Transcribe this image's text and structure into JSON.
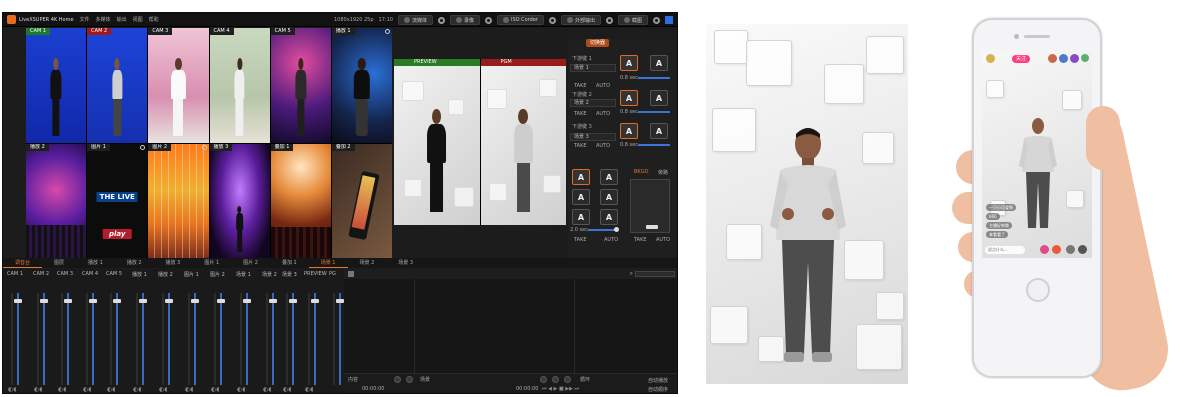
{
  "app": {
    "title": "LiveXSUPER 4K Home",
    "menu": [
      "文件",
      "多媒体",
      "输出",
      "视图",
      "帮助"
    ],
    "format": "1080x1920 25p",
    "clock": "17:10",
    "buttons": {
      "stream": "流媒体",
      "record": "录像",
      "iso": "ISO Corder",
      "external": "外部输出",
      "screenshot": "截图"
    }
  },
  "multiview": [
    {
      "label": "CAM 1",
      "state": "preview"
    },
    {
      "label": "CAM 2",
      "state": "program"
    },
    {
      "label": "CAM 3",
      "state": ""
    },
    {
      "label": "CAM 4",
      "state": ""
    },
    {
      "label": "CAM 5",
      "state": ""
    },
    {
      "label": "播放 1",
      "state": ""
    },
    {
      "label": "播放 2",
      "state": ""
    },
    {
      "label": "图片 1",
      "state": ""
    },
    {
      "label": "图片 2",
      "state": ""
    },
    {
      "label": "播放 3",
      "state": ""
    },
    {
      "label": "叠加 1",
      "state": ""
    },
    {
      "label": "叠加 2",
      "state": ""
    }
  ],
  "overlays": {
    "live": "THE LIVE",
    "play": "play"
  },
  "monitors": {
    "preview": "PREVIEW",
    "program": "PGM"
  },
  "transition": {
    "tab": "切换器",
    "groups": [
      {
        "title": "下游键 1",
        "source": "场景 1",
        "duration": "0.8 sec"
      },
      {
        "title": "下游键 2",
        "source": "场景 2",
        "duration": "0.8 sec"
      },
      {
        "title": "下游键 3",
        "source": "场景 3",
        "duration": "0.8 sec"
      }
    ],
    "take": "TAKE",
    "auto": "AUTO",
    "a": "A",
    "main_duration": "2.0 sec",
    "ftb": "BKGD",
    "ftb2": "旁路"
  },
  "bottom_tabs": [
    "调音台",
    "图层",
    "播放 1",
    "播放 2",
    "播放 3",
    "图片 1",
    "图片 2",
    "叠加 1",
    "场景 1",
    "场景 2",
    "场景 3"
  ],
  "mixer_channels": [
    "CAM 1",
    "CAM 2",
    "CAM 3",
    "CAM 4",
    "CAM 5",
    "播放 1",
    "播放 2",
    "图片 1",
    "图片 2",
    "场景 1",
    "场景 2",
    "场景 3",
    "PREVIEW",
    "PG"
  ],
  "media": {
    "footer_left": "内容",
    "footer_mid": "场景",
    "time_left": "00:00:00",
    "time_right": "00:00:00",
    "loop": "循环",
    "auto_play": "自动播放",
    "auto_next": "自动顺序"
  },
  "phone": {
    "follow": "关注",
    "chat": [
      "一只小可爱啊",
      "666",
      "主播好帅哦",
      "来看看了"
    ],
    "input_placeholder": "说点什么..."
  },
  "colors": {
    "accent": "#e46a1d",
    "preview": "#2a7b22",
    "program": "#9a1b1b",
    "fader": "#3a6ac0"
  }
}
